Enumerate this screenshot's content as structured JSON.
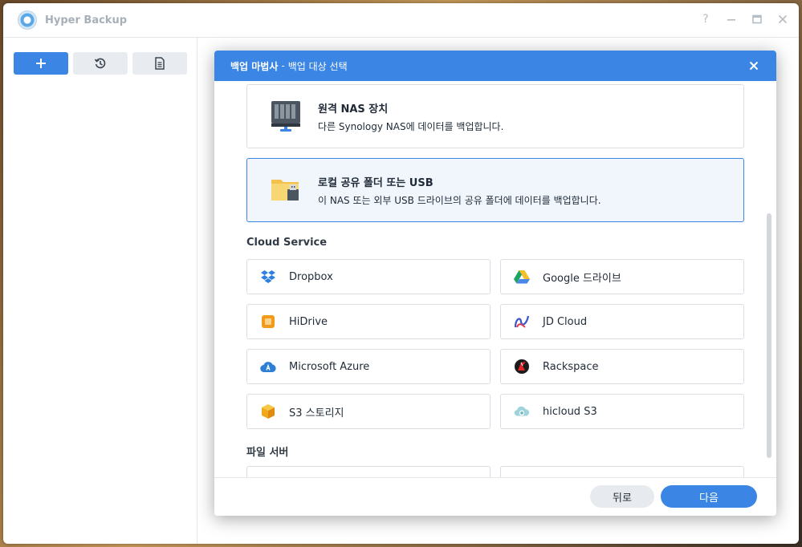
{
  "app": {
    "title": "Hyper Backup"
  },
  "window_controls": {
    "help": "?"
  },
  "modal": {
    "title_main": "백업 마법사",
    "title_sep": "-",
    "title_sub": "백업 대상 선택",
    "cards": [
      {
        "title": "원격 NAS 장치",
        "desc": "다른 Synology NAS에 데이터를 백업합니다.",
        "icon": "nas-device-icon",
        "selected": false
      },
      {
        "title": "로컬 공유 폴더 또는 USB",
        "desc": "이 NAS 또는 외부 USB 드라이브의 공유 폴더에 데이터를 백업합니다.",
        "icon": "folder-usb-icon",
        "selected": true
      }
    ],
    "cloud_section_title": "Cloud Service",
    "cloud_services": [
      {
        "label": "Dropbox",
        "icon": "dropbox-icon"
      },
      {
        "label": "Google 드라이브",
        "icon": "google-drive-icon"
      },
      {
        "label": "HiDrive",
        "icon": "hidrive-icon"
      },
      {
        "label": "JD Cloud",
        "icon": "jd-cloud-icon"
      },
      {
        "label": "Microsoft Azure",
        "icon": "azure-icon"
      },
      {
        "label": "Rackspace",
        "icon": "rackspace-icon"
      },
      {
        "label": "S3 스토리지",
        "icon": "s3-icon"
      },
      {
        "label": "hicloud S3",
        "icon": "hicloud-icon"
      }
    ],
    "file_server_section_title": "파일 서버",
    "back_label": "뒤로",
    "next_label": "다음"
  },
  "colors": {
    "accent": "#3b86e5",
    "selected_bg": "#f1f6fd",
    "border": "#d9dee3"
  }
}
